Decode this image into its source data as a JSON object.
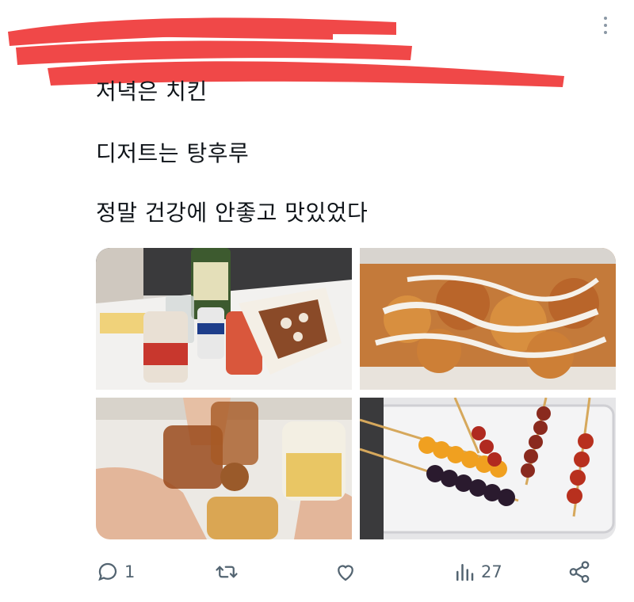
{
  "post": {
    "lines": [
      "저녁은 치킨",
      "디저트는 탕후루",
      "정말 건강에 안좋고 맛있었다"
    ]
  },
  "images": [
    {
      "description": "drinks and chicken on table"
    },
    {
      "description": "yangnyeom chicken close-up"
    },
    {
      "description": "cheers with beer and soju"
    },
    {
      "description": "tanghulu skewers"
    }
  ],
  "actions": {
    "reply_count": "1",
    "views_count": "27"
  },
  "icons": [
    "more-icon",
    "reply-icon",
    "retweet-icon",
    "like-icon",
    "views-icon",
    "share-icon"
  ],
  "colors": {
    "redaction": "#f04848",
    "icon": "#536471",
    "text": "#0f1419"
  }
}
